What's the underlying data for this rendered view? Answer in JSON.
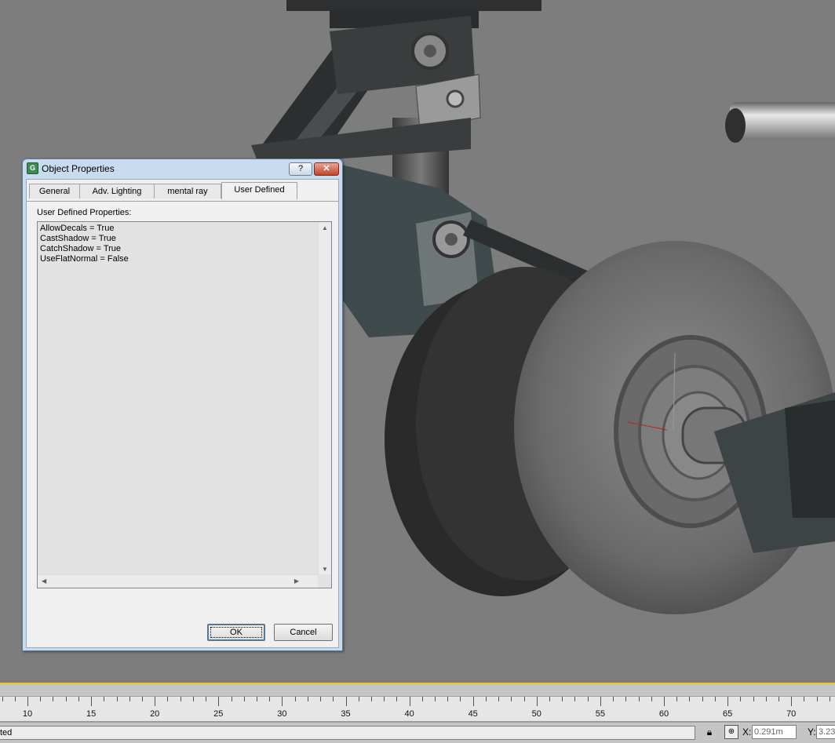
{
  "dialog": {
    "title": "Object Properties",
    "help_label": "?",
    "close_label": "✕",
    "tabs": [
      {
        "label": "General"
      },
      {
        "label": "Adv. Lighting"
      },
      {
        "label": "mental ray"
      },
      {
        "label": "User Defined"
      }
    ],
    "active_tab": "User Defined",
    "properties_label": "User Defined Properties:",
    "properties_lines": [
      "AllowDecals = True",
      "CastShadow = True",
      "CatchShadow = True",
      "UseFlatNormal = False"
    ],
    "ok_label": "OK",
    "cancel_label": "Cancel"
  },
  "timeline": {
    "ticks": [
      "10",
      "15",
      "20",
      "25",
      "30",
      "35",
      "40",
      "45",
      "50",
      "55",
      "60",
      "65",
      "70"
    ],
    "accent_color": "#f0c419"
  },
  "status": {
    "text": "ted",
    "x_label": "X:",
    "x_value": "0.291m",
    "y_label": "Y:",
    "y_value": "3.23"
  },
  "icons": {
    "lock": "lock-icon",
    "snap": "snap-toggle-icon",
    "app": "app-icon"
  }
}
